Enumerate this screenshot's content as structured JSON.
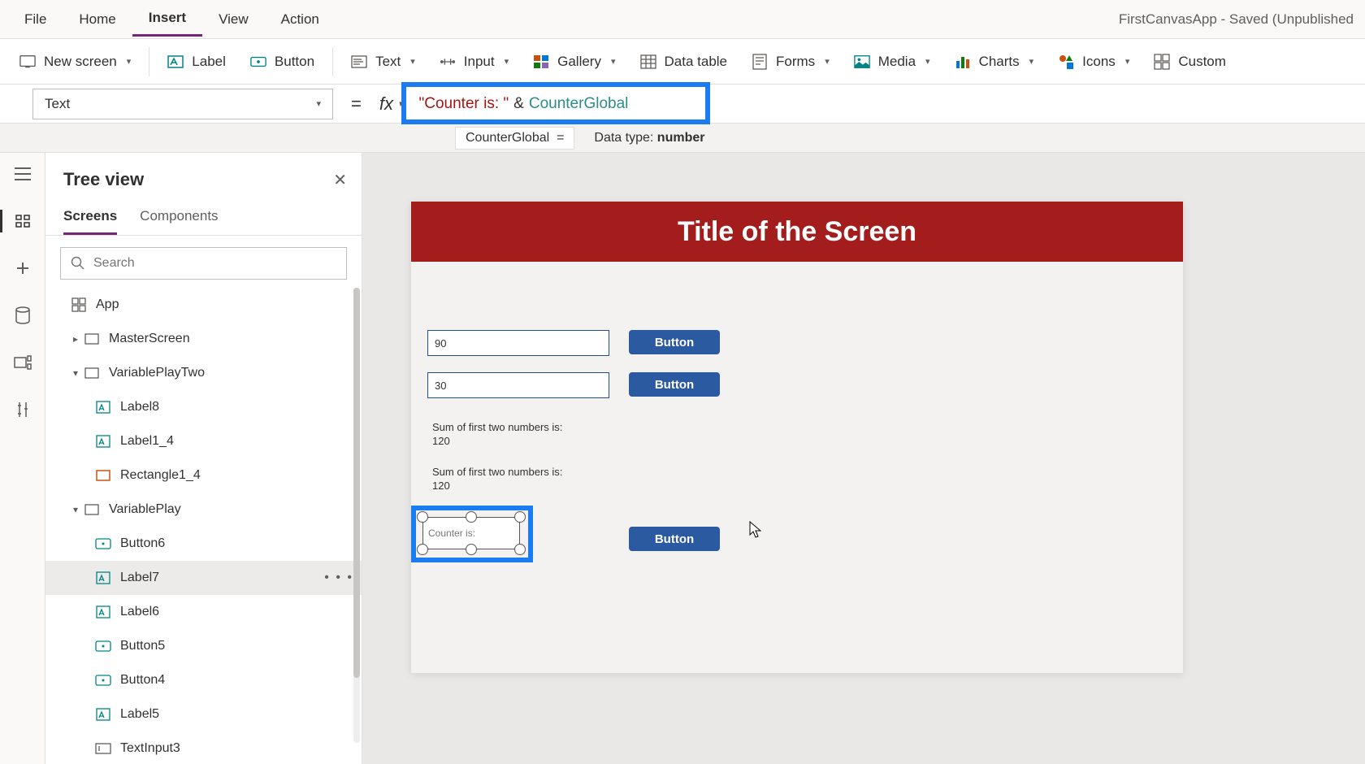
{
  "app_title": "FirstCanvasApp - Saved (Unpublished",
  "menu": {
    "file": "File",
    "home": "Home",
    "insert": "Insert",
    "view": "View",
    "action": "Action"
  },
  "ribbon": {
    "new_screen": "New screen",
    "label": "Label",
    "button": "Button",
    "text": "Text",
    "input": "Input",
    "gallery": "Gallery",
    "data_table": "Data table",
    "forms": "Forms",
    "media": "Media",
    "charts": "Charts",
    "icons": "Icons",
    "custom": "Custom"
  },
  "property_selector": "Text",
  "formula": {
    "str": "\"Counter is: \"",
    "op": "&",
    "var": "CounterGlobal"
  },
  "intelli": {
    "var": "CounterGlobal",
    "eq": "=",
    "dt_label": "Data type:",
    "dt_value": "number"
  },
  "tree": {
    "title": "Tree view",
    "tab_screens": "Screens",
    "tab_components": "Components",
    "search_placeholder": "Search",
    "nodes": {
      "app": "App",
      "master": "MasterScreen",
      "vp2": "VariablePlayTwo",
      "label8": "Label8",
      "label1_4": "Label1_4",
      "rect1_4": "Rectangle1_4",
      "vp": "VariablePlay",
      "button6": "Button6",
      "label7": "Label7",
      "label6": "Label6",
      "button5": "Button5",
      "button4": "Button4",
      "label5": "Label5",
      "textinput3": "TextInput3"
    }
  },
  "canvas": {
    "title": "Title of the Screen",
    "input1": "90",
    "input2": "30",
    "btn": "Button",
    "sum1": "Sum of first two numbers is: 120",
    "sum2": "Sum of first two numbers is: 120",
    "sel_label": "Counter is:"
  }
}
